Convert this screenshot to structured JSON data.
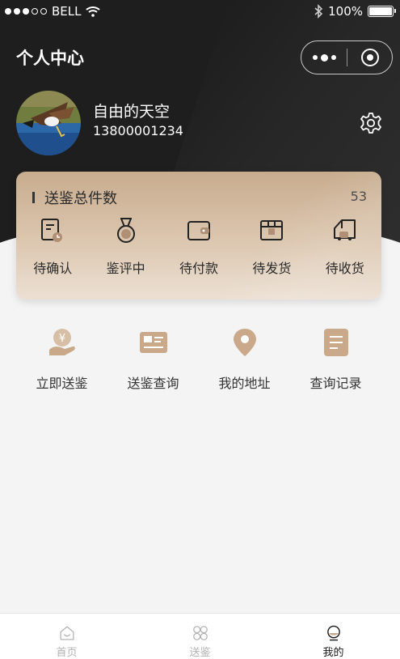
{
  "status_bar": {
    "carrier": "BELL",
    "battery": "100%"
  },
  "header": {
    "title": "个人中心"
  },
  "user": {
    "name": "自由的天空",
    "phone": "13800001234"
  },
  "submit_card": {
    "title": "送鉴总件数",
    "count": "53",
    "items": [
      {
        "label": "待确认",
        "icon": "pending-confirm-icon"
      },
      {
        "label": "鉴评中",
        "icon": "medal-icon"
      },
      {
        "label": "待付款",
        "icon": "wallet-icon"
      },
      {
        "label": "待发货",
        "icon": "ship-box-icon"
      },
      {
        "label": "待收货",
        "icon": "truck-icon"
      }
    ]
  },
  "quick_actions": [
    {
      "label": "立即送鉴",
      "icon": "yen-hand-icon"
    },
    {
      "label": "送鉴查询",
      "icon": "id-card-icon"
    },
    {
      "label": "我的地址",
      "icon": "location-pin-icon"
    },
    {
      "label": "查询记录",
      "icon": "document-list-icon"
    }
  ],
  "tabbar": {
    "items": [
      {
        "label": "首页",
        "icon": "home-icon",
        "active": false
      },
      {
        "label": "送鉴",
        "icon": "clover-icon",
        "active": false
      },
      {
        "label": "我的",
        "icon": "profile-icon",
        "active": true
      }
    ]
  },
  "colors": {
    "header_bg": "#1e1e1e",
    "card_gold": "#c8ac8e",
    "icon_gold": "#c9a98a",
    "tab_active": "#1a1a1a",
    "tab_inactive": "#b3b3b3"
  }
}
